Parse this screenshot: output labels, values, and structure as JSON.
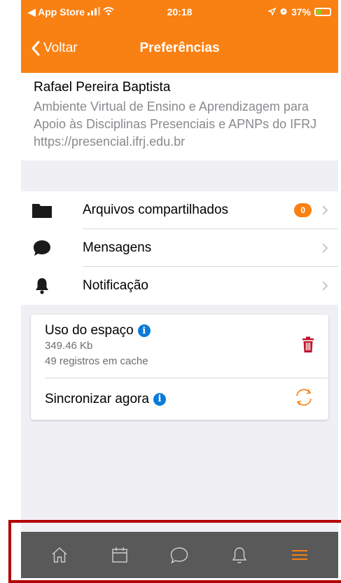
{
  "status_bar": {
    "carrier": "◀ App Store",
    "time": "20:18",
    "battery": "37%",
    "battery_level": 0.37
  },
  "nav": {
    "back_label": "Voltar",
    "title": "Preferências"
  },
  "profile": {
    "name": "Rafael Pereira Baptista",
    "site_name": "Ambiente Virtual de Ensino e Aprendizagem para Apoio às Disciplinas Presenciais e APNPs do IFRJ",
    "site_url": "https://presencial.ifrj.edu.br"
  },
  "menu": {
    "items": [
      {
        "label": "Arquivos compartilhados",
        "icon": "folder-icon",
        "badge": "0"
      },
      {
        "label": "Mensagens",
        "icon": "chat-bubble-icon"
      },
      {
        "label": "Notificação",
        "icon": "bell-icon"
      }
    ]
  },
  "storage": {
    "title": "Uso do espaço",
    "size": "349.46 Kb",
    "cache": "49 registros em cache",
    "sync_label": "Sincronizar agora"
  },
  "tabbar": {
    "tabs": [
      "home-icon",
      "calendar-icon",
      "messages-icon",
      "notifications-icon",
      "menu-icon"
    ],
    "active": "menu-icon"
  },
  "colors": {
    "brand": "#f98012",
    "tabbar": "#595959",
    "info": "#0a7bd8",
    "delete": "#c0142a",
    "highlight_frame": "#b30000"
  }
}
